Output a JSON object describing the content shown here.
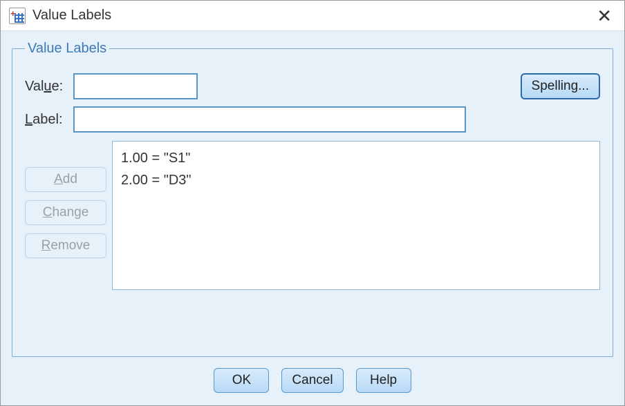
{
  "titlebar": {
    "title": "Value Labels"
  },
  "group": {
    "legend": "Value Labels",
    "value_label": "Value:",
    "value_label_ulchar": "u",
    "label_label": "Label:",
    "label_label_ulchar": "L",
    "value_input": "",
    "label_input": "",
    "spelling_btn": "Spelling...",
    "add_btn": "Add",
    "change_btn": "Change",
    "remove_btn": "Remove",
    "list": [
      "1.00 = \"S1\"",
      "2.00 = \"D3\""
    ]
  },
  "footer": {
    "ok": "OK",
    "cancel": "Cancel",
    "help": "Help"
  }
}
